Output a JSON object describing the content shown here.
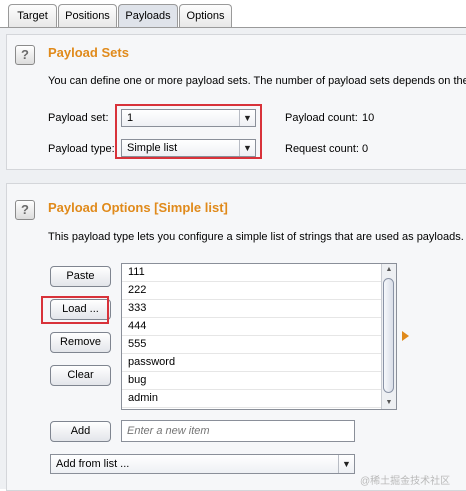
{
  "tabs": [
    {
      "label": "Target",
      "active": false
    },
    {
      "label": "Positions",
      "active": false
    },
    {
      "label": "Payloads",
      "active": true
    },
    {
      "label": "Options",
      "active": false
    }
  ],
  "payload_sets": {
    "help_glyph": "?",
    "title": "Payload Sets",
    "description": "You can define one or more payload sets. The number of payload sets depends on the",
    "set_label": "Payload set:",
    "set_value": "1",
    "type_label": "Payload type:",
    "type_value": "Simple list",
    "count_label": "Payload count:",
    "count_value": "10",
    "request_label": "Request count:",
    "request_value": "0"
  },
  "payload_options": {
    "help_glyph": "?",
    "title": "Payload Options [Simple list]",
    "description": "This payload type lets you configure a simple list of strings that are used as payloads.",
    "buttons": {
      "paste": "Paste",
      "load": "Load ...",
      "remove": "Remove",
      "clear": "Clear",
      "add": "Add"
    },
    "items": [
      "111",
      "222",
      "333",
      "444",
      "555",
      "password",
      "bug",
      "admin"
    ],
    "add_placeholder": "Enter a new item",
    "add_from_list": "Add from list ..."
  },
  "watermark": "@稀土掘金技术社区",
  "colors": {
    "accent": "#e08a1b",
    "highlight": "#d8323a"
  }
}
